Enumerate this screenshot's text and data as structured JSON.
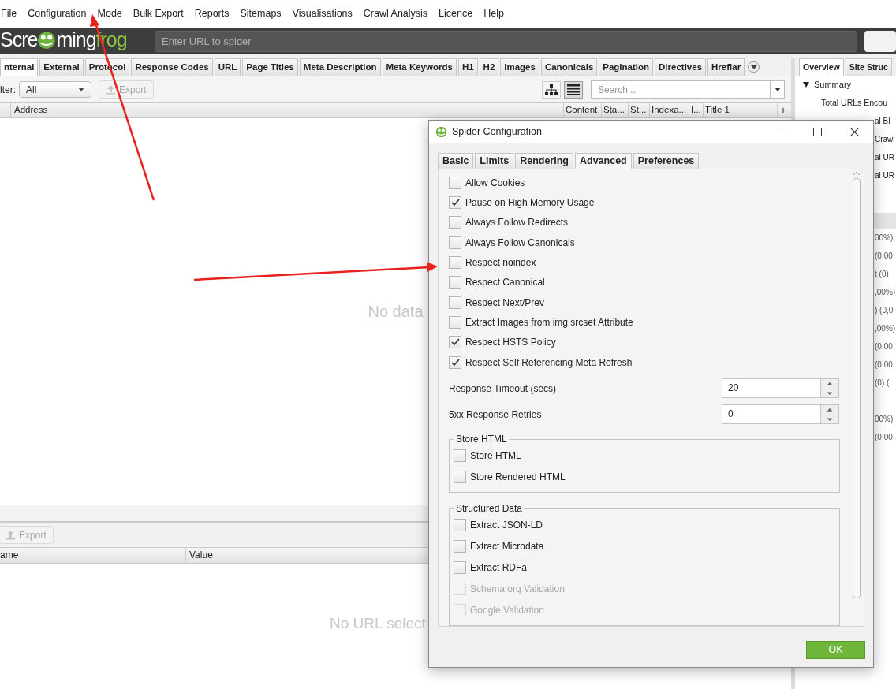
{
  "menu": [
    "File",
    "Configuration",
    "Mode",
    "Bulk Export",
    "Reports",
    "Sitemaps",
    "Visualisations",
    "Crawl Analysis",
    "Licence",
    "Help"
  ],
  "logo": {
    "parts": [
      "Scre",
      "ming",
      "frog"
    ]
  },
  "url_field": {
    "placeholder": "Enter URL to spider"
  },
  "main": {
    "tabs": [
      {
        "label": "nternal",
        "selected": true
      },
      {
        "label": "External",
        "selected": false
      },
      {
        "label": "Protocol",
        "selected": false
      },
      {
        "label": "Response Codes",
        "selected": false
      },
      {
        "label": "URL",
        "selected": false
      },
      {
        "label": "Page Titles",
        "selected": false
      },
      {
        "label": "Meta Description",
        "selected": false
      },
      {
        "label": "Meta Keywords",
        "selected": false
      },
      {
        "label": "H1",
        "selected": false
      },
      {
        "label": "H2",
        "selected": false
      },
      {
        "label": "Images",
        "selected": false
      },
      {
        "label": "Canonicals",
        "selected": false
      },
      {
        "label": "Pagination",
        "selected": false
      },
      {
        "label": "Directives",
        "selected": false
      },
      {
        "label": "Hreflar",
        "selected": false
      }
    ],
    "filter_label": "lter:",
    "filter_value": "All",
    "export_button": {
      "label": "Export",
      "disabled": true
    },
    "views": [
      {
        "kind": "tree",
        "selected": false
      },
      {
        "kind": "list",
        "selected": true
      }
    ],
    "search": {
      "placeholder": "Search..."
    },
    "columns": [
      "Address",
      "Content",
      "Sta...",
      "St...",
      "Indexa...",
      "I...",
      "Title 1"
    ],
    "add_column": "+",
    "empty_text": "No data"
  },
  "details": {
    "export_button": {
      "label": "Export",
      "disabled": true
    },
    "columns": [
      "ame",
      "Value"
    ],
    "empty_text": "No URL select"
  },
  "side": {
    "tabs": [
      {
        "label": "Overview",
        "selected": true
      },
      {
        "label": "Site Struc",
        "selected": false
      }
    ],
    "summary": {
      "label": "Summary",
      "expanded": true,
      "items": [
        "Total URLs Encou",
        "al Bl",
        "Crawl",
        "al UR",
        "al UR"
      ]
    },
    "rows_a": [
      "00%)",
      "(0,00",
      "t (0)",
      ",00%)",
      ") (0,0",
      ",00%)",
      "(0,00",
      "(0,00",
      "(0) ("
    ],
    "rows_b": [
      "00%)",
      "(0,00"
    ]
  },
  "dialog": {
    "title": "Spider Configuration",
    "tabs": [
      {
        "label": "Basic",
        "selected": false
      },
      {
        "label": "Limits",
        "selected": false
      },
      {
        "label": "Rendering",
        "selected": false
      },
      {
        "label": "Advanced",
        "selected": true
      },
      {
        "label": "Preferences",
        "selected": false
      }
    ],
    "options": [
      {
        "label": "Allow Cookies",
        "checked": false
      },
      {
        "label": "Pause on High Memory Usage",
        "checked": true
      },
      {
        "label": "Always Follow Redirects",
        "checked": false
      },
      {
        "label": "Always Follow Canonicals",
        "checked": false
      },
      {
        "label": "Respect noindex",
        "checked": false
      },
      {
        "label": "Respect Canonical",
        "checked": false
      },
      {
        "label": "Respect Next/Prev",
        "checked": false
      },
      {
        "label": "Extract Images from img srcset Attribute",
        "checked": false
      },
      {
        "label": "Respect HSTS Policy",
        "checked": true
      },
      {
        "label": "Respect Self Referencing Meta Refresh",
        "checked": true
      }
    ],
    "spinners": [
      {
        "label": "Response Timeout (secs)",
        "value": "20"
      },
      {
        "label": "5xx Response Retries",
        "value": "0"
      }
    ],
    "groups": [
      {
        "title": "Store HTML",
        "options": [
          {
            "label": "Store HTML",
            "checked": false,
            "disabled": false
          },
          {
            "label": "Store Rendered HTML",
            "checked": false,
            "disabled": false
          }
        ]
      },
      {
        "title": "Structured Data",
        "options": [
          {
            "label": "Extract JSON-LD",
            "checked": false,
            "disabled": false
          },
          {
            "label": "Extract Microdata",
            "checked": false,
            "disabled": false
          },
          {
            "label": "Extract RDFa",
            "checked": false,
            "disabled": false
          },
          {
            "label": "Schema.org Validation",
            "checked": false,
            "disabled": true
          },
          {
            "label": "Google Validation",
            "checked": false,
            "disabled": true
          }
        ]
      }
    ],
    "ok_button": "OK"
  }
}
